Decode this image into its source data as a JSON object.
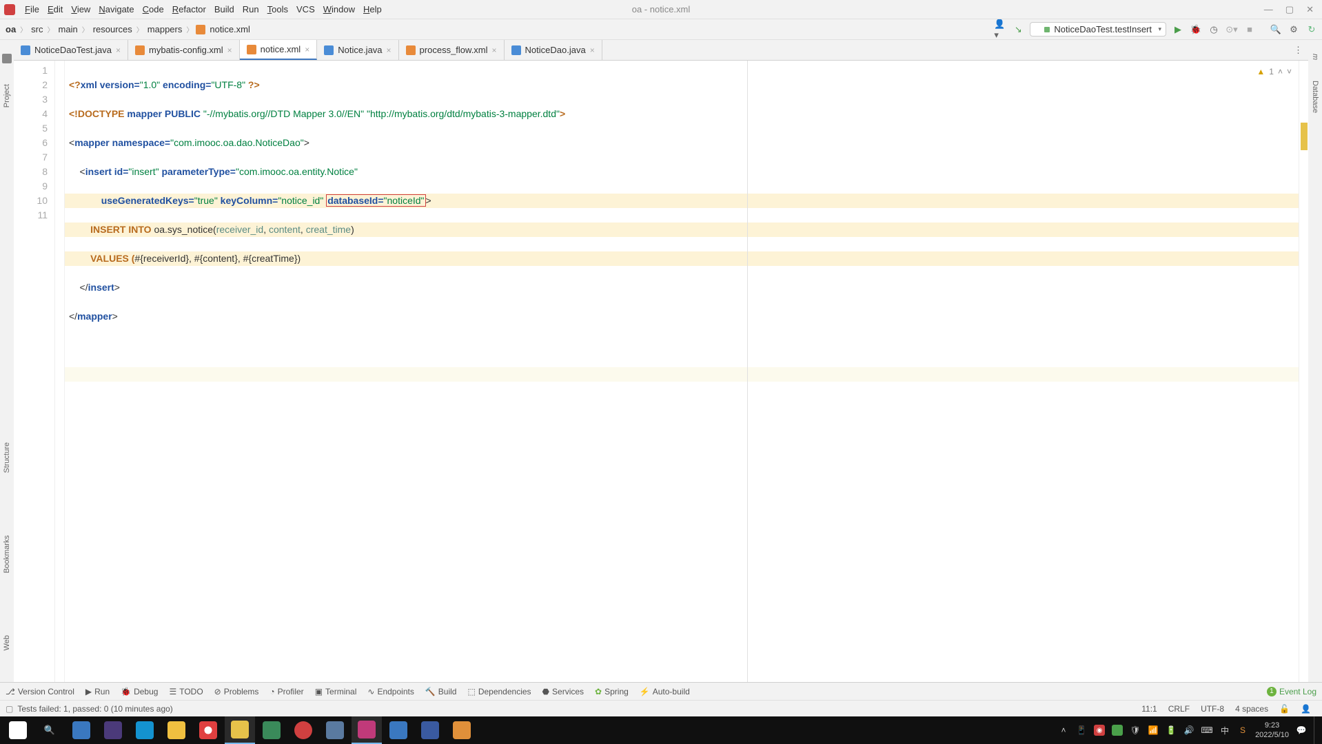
{
  "window": {
    "title": "oa - notice.xml"
  },
  "menu": {
    "file": "File",
    "edit": "Edit",
    "view": "View",
    "navigate": "Navigate",
    "code": "Code",
    "refactor": "Refactor",
    "build": "Build",
    "run": "Run",
    "tools": "Tools",
    "vcs": "VCS",
    "window": "Window",
    "help": "Help"
  },
  "breadcrumb": {
    "p0": "oa",
    "p1": "src",
    "p2": "main",
    "p3": "resources",
    "p4": "mappers",
    "p5": "notice.xml"
  },
  "toolbar": {
    "run_config": "NoticeDaoTest.testInsert"
  },
  "gutters": {
    "project": "Project",
    "structure": "Structure",
    "bookmarks": "Bookmarks",
    "web": "Web",
    "maven": "Maven",
    "database": "Database"
  },
  "tabs": [
    {
      "label": "NoticeDaoTest.java",
      "type": "java"
    },
    {
      "label": "mybatis-config.xml",
      "type": "xml"
    },
    {
      "label": "notice.xml",
      "type": "xml"
    },
    {
      "label": "Notice.java",
      "type": "java"
    },
    {
      "label": "process_flow.xml",
      "type": "xml"
    },
    {
      "label": "NoticeDao.java",
      "type": "java"
    }
  ],
  "lines": [
    "1",
    "2",
    "3",
    "4",
    "5",
    "6",
    "7",
    "8",
    "9",
    "10",
    "11"
  ],
  "code": {
    "l1_a": "<?",
    "l1_b": "xml version=",
    "l1_c": "\"1.0\"",
    "l1_d": " encoding=",
    "l1_e": "\"UTF-8\"",
    "l1_f": " ?>",
    "l2_a": "<!DOCTYPE ",
    "l2_b": "mapper ",
    "l2_c": "PUBLIC ",
    "l2_d": "\"-//mybatis.org//DTD Mapper 3.0//EN\" \"http://mybatis.org/dtd/mybatis-3-mapper.dtd\"",
    "l2_e": ">",
    "l3_a": "<",
    "l3_b": "mapper ",
    "l3_c": "namespace=",
    "l3_d": "\"com.imooc.oa.dao.NoticeDao\"",
    "l3_e": ">",
    "l4_a": "    <",
    "l4_b": "insert ",
    "l4_c": "id=",
    "l4_d": "\"insert\"",
    "l4_e": " parameterType=",
    "l4_f": "\"com.imooc.oa.entity.Notice\"",
    "l5_a": "            ",
    "l5_b": "useGeneratedKeys=",
    "l5_c": "\"true\"",
    "l5_d": " keyColumn=",
    "l5_e": "\"notice_id\"",
    "l5_f": " ",
    "l5_box_a": "databaseId=",
    "l5_box_b": "\"noticeId\"",
    "l5_g": ">",
    "l6_a": "        INSERT INTO ",
    "l6_b": "oa.sys_notice(",
    "l6_c": "receiver_id",
    "l6_d": ", ",
    "l6_e": "content",
    "l6_f": ", ",
    "l6_g": "creat_time",
    "l6_h": ")",
    "l7_a": "        VALUES (",
    "l7_b": "#{receiverId}, #{content}, #{creatTime}",
    "l7_c": ")",
    "l8_a": "    </",
    "l8_b": "insert",
    "l8_c": ">",
    "l9_a": "</",
    "l9_b": "mapper",
    "l9_c": ">"
  },
  "inspection": {
    "warning_count": "1"
  },
  "bottom": {
    "version_control": "Version Control",
    "run": "Run",
    "debug": "Debug",
    "todo": "TODO",
    "problems": "Problems",
    "profiler": "Profiler",
    "terminal": "Terminal",
    "endpoints": "Endpoints",
    "build": "Build",
    "dependencies": "Dependencies",
    "services": "Services",
    "spring": "Spring",
    "auto_build": "Auto-build",
    "event_log": "Event Log"
  },
  "status": {
    "msg": "Tests failed: 1, passed: 0 (10 minutes ago)",
    "pos": "11:1",
    "lineend": "CRLF",
    "encoding": "UTF-8",
    "indent": "4 spaces"
  },
  "tray": {
    "ime": "中",
    "time": "9:23",
    "date": "2022/5/10"
  }
}
